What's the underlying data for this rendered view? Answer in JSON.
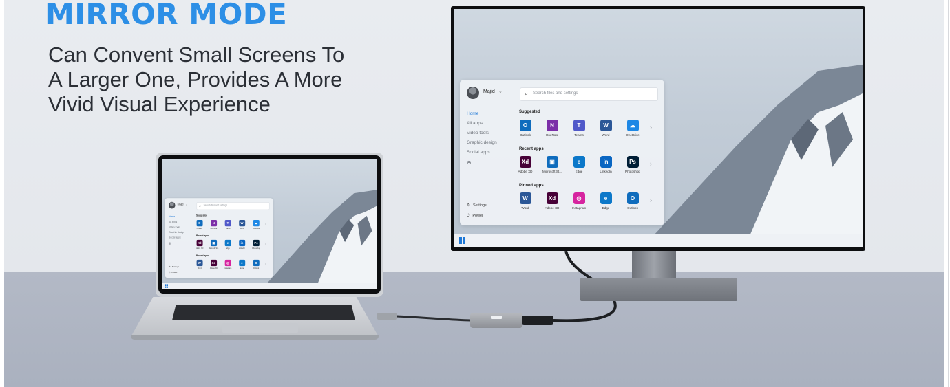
{
  "headline": "MIRROR MODE",
  "subtitle_lines": [
    "Can Convent Small Screens To",
    "A Larger One, Provides A More",
    "Vivid Visual Experience"
  ],
  "colors": {
    "headline": "#2d8fe6",
    "subtitle": "#2b2f36",
    "accent": "#1e78d6"
  },
  "start_menu": {
    "user": "Majid",
    "search_placeholder": "Search files and settings",
    "nav": [
      "Home",
      "All apps",
      "Video tools",
      "Graphic design",
      "Social apps"
    ],
    "sections": {
      "suggested": "Suggested",
      "recent": "Recent apps",
      "pinned": "Pinned apps"
    },
    "suggested_apps": [
      {
        "name": "Outlook",
        "icon": "outlook-icon",
        "glyph": "O",
        "color": "#0f6cbd"
      },
      {
        "name": "OneNote",
        "icon": "onenote-icon",
        "glyph": "N",
        "color": "#7b2fa8"
      },
      {
        "name": "Teams",
        "icon": "teams-icon",
        "glyph": "T",
        "color": "#5059c9"
      },
      {
        "name": "Word",
        "icon": "word-icon",
        "glyph": "W",
        "color": "#2b5797"
      },
      {
        "name": "OneDrive",
        "icon": "onedrive-icon",
        "glyph": "☁",
        "color": "#1e88e5"
      }
    ],
    "recent_apps": [
      {
        "name": "Adobe XD",
        "icon": "adobe-xd-icon",
        "glyph": "Xd",
        "color": "#470137"
      },
      {
        "name": "Microsoft St...",
        "icon": "microsoft-store-icon",
        "glyph": "▣",
        "color": "#0f6cbd"
      },
      {
        "name": "Edge",
        "icon": "edge-icon",
        "glyph": "e",
        "color": "#0c78c9"
      },
      {
        "name": "LinkedIn",
        "icon": "linkedin-icon",
        "glyph": "in",
        "color": "#0a66c2"
      },
      {
        "name": "Photoshop",
        "icon": "photoshop-icon",
        "glyph": "Ps",
        "color": "#001e36"
      }
    ],
    "pinned_apps": [
      {
        "name": "Word",
        "icon": "word-icon",
        "glyph": "W",
        "color": "#2b5797"
      },
      {
        "name": "Adobe XD",
        "icon": "adobe-xd-icon",
        "glyph": "Xd",
        "color": "#470137"
      },
      {
        "name": "Instagram",
        "icon": "instagram-icon",
        "glyph": "◎",
        "color": "#d6249f"
      },
      {
        "name": "Edge",
        "icon": "edge-icon",
        "glyph": "e",
        "color": "#0c78c9"
      },
      {
        "name": "Outlook",
        "icon": "outlook-icon",
        "glyph": "O",
        "color": "#0f6cbd"
      }
    ],
    "settings": "Settings",
    "power": "Power"
  }
}
